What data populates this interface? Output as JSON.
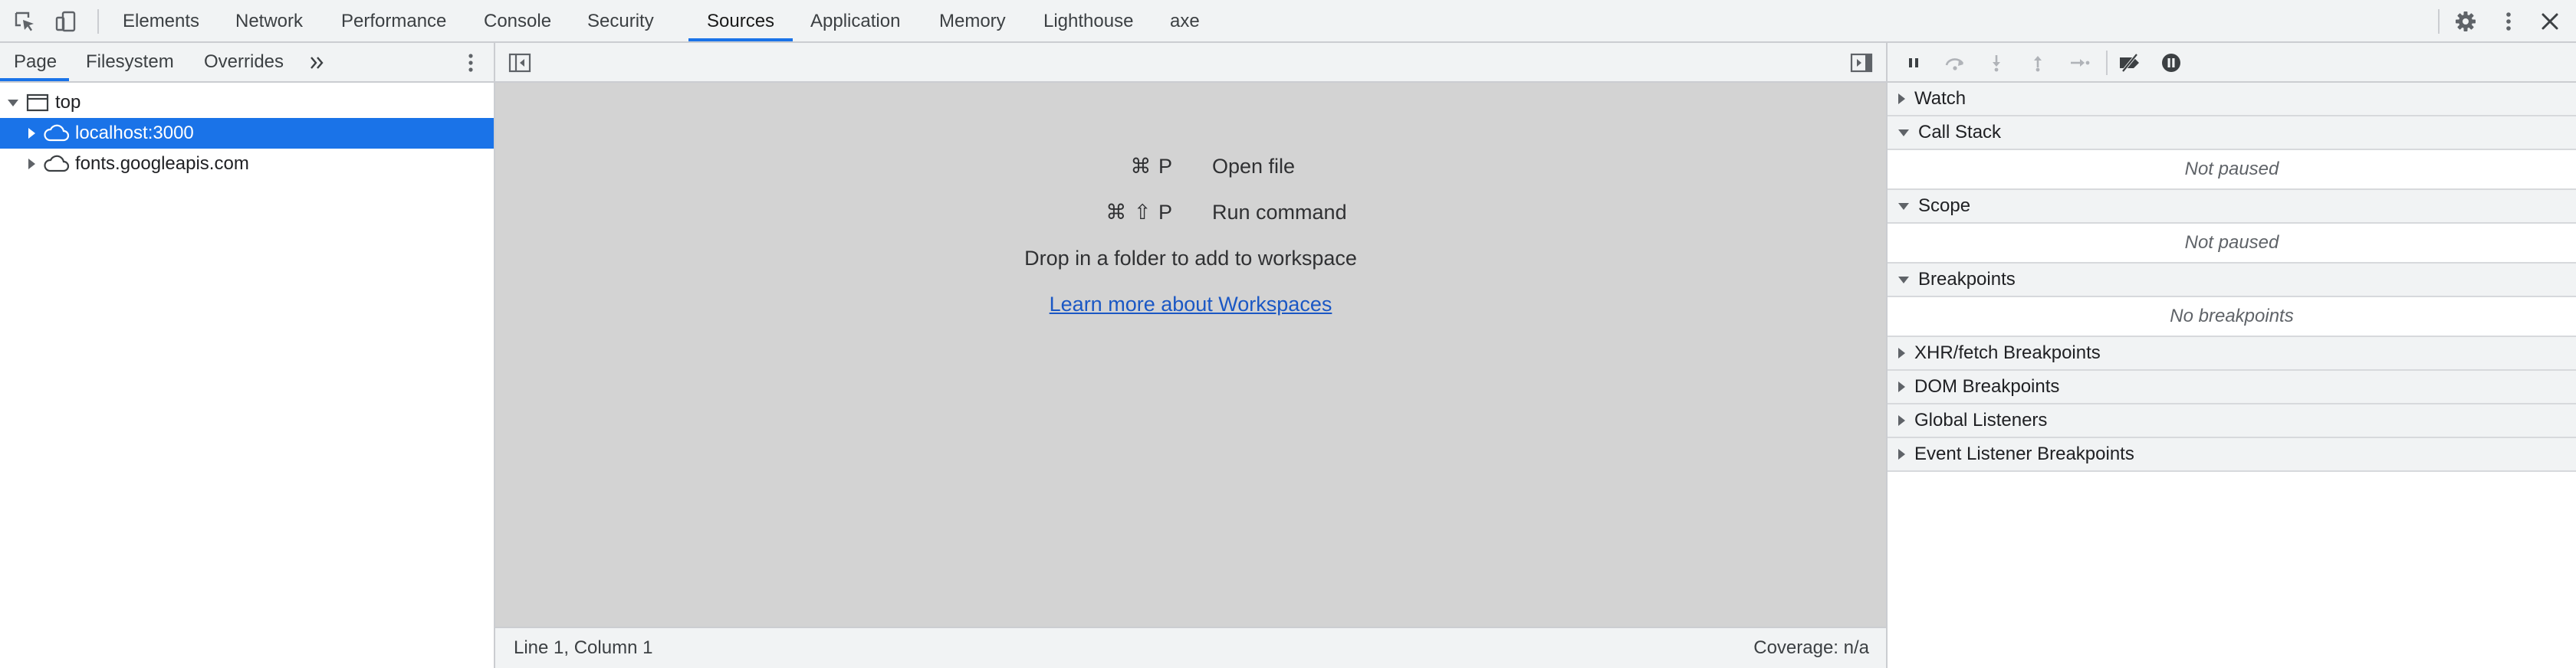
{
  "toolbar": {
    "tabs": [
      {
        "label": "Elements"
      },
      {
        "label": "Network"
      },
      {
        "label": "Performance"
      },
      {
        "label": "Console"
      },
      {
        "label": "Security"
      },
      {
        "label": "Sources",
        "active": true
      },
      {
        "label": "Application"
      },
      {
        "label": "Memory"
      },
      {
        "label": "Lighthouse"
      },
      {
        "label": "axe"
      }
    ],
    "left_icons": [
      "inspect-element-icon",
      "device-toolbar-icon"
    ],
    "right_icons": [
      "settings-gear-icon",
      "more-options-icon",
      "close-icon"
    ]
  },
  "navigator": {
    "tabs": [
      {
        "label": "Page",
        "active": true
      },
      {
        "label": "Filesystem"
      },
      {
        "label": "Overrides"
      }
    ],
    "more_tabs_icon": "chevron-double-right-icon",
    "menu_icon": "more-vertical-icon",
    "tree": [
      {
        "label": "top",
        "icon": "frame-icon",
        "expanded": true
      },
      {
        "label": "localhost:3000",
        "icon": "cloud-icon",
        "expanded": false,
        "selected": true
      },
      {
        "label": "fonts.googleapis.com",
        "icon": "cloud-icon",
        "expanded": false
      }
    ]
  },
  "editor": {
    "toggle_navigator_icon": "toggle-navigator-icon",
    "toggle_debugger_icon": "toggle-debugger-icon",
    "shortcuts": [
      {
        "keys": "⌘ P",
        "label": "Open file"
      },
      {
        "keys": "⌘ ⇧ P",
        "label": "Run command"
      }
    ],
    "drop_hint": "Drop in a folder to add to workspace",
    "learn_more_link": "Learn more about Workspaces",
    "status": {
      "position": "Line 1, Column 1",
      "coverage": "Coverage: n/a"
    }
  },
  "debugger": {
    "controls": [
      "pause-icon",
      "step-over-icon",
      "step-into-icon",
      "step-out-icon",
      "step-icon",
      "deactivate-breakpoints-icon",
      "pause-on-exceptions-icon"
    ],
    "sections": [
      {
        "title": "Watch",
        "expanded": false
      },
      {
        "title": "Call Stack",
        "expanded": true,
        "body": "Not paused"
      },
      {
        "title": "Scope",
        "expanded": true,
        "body": "Not paused"
      },
      {
        "title": "Breakpoints",
        "expanded": true,
        "body": "No breakpoints"
      },
      {
        "title": "XHR/fetch Breakpoints",
        "expanded": false
      },
      {
        "title": "DOM Breakpoints",
        "expanded": false
      },
      {
        "title": "Global Listeners",
        "expanded": false
      },
      {
        "title": "Event Listener Breakpoints",
        "expanded": false
      }
    ]
  },
  "colors": {
    "accent": "#1a73e8",
    "toolbar_bg": "#f1f3f4",
    "editor_bg": "#d3d3d3",
    "link": "#1a57c4"
  }
}
